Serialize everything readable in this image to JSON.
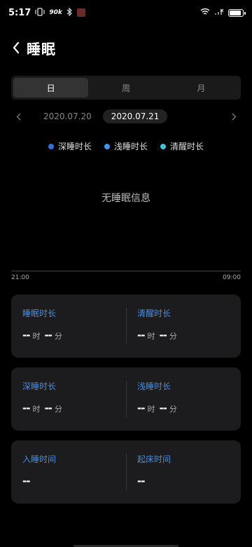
{
  "status": {
    "time": "5:17",
    "speed": "90k"
  },
  "page": {
    "title": "睡眠"
  },
  "tabs": [
    {
      "label": "日"
    },
    {
      "label": "周"
    },
    {
      "label": "月"
    }
  ],
  "date": {
    "previous": "2020.07.20",
    "current": "2020.07.21"
  },
  "legend": [
    {
      "label": "深睡时长",
      "color": "#2f73d8"
    },
    {
      "label": "浅睡时长",
      "color": "#3e97ec"
    },
    {
      "label": "清醒时长",
      "color": "#36c6d8"
    }
  ],
  "empty_message": "无睡眠信息",
  "axis": {
    "start": "21:00",
    "end": "09:00"
  },
  "cards": {
    "sleep_duration": {
      "label": "睡眠时长",
      "hours": "--",
      "hour_unit": "时",
      "minutes": "--",
      "minute_unit": "分"
    },
    "awake_duration": {
      "label": "清醒时长",
      "hours": "--",
      "hour_unit": "时",
      "minutes": "--",
      "minute_unit": "分"
    },
    "deep_duration": {
      "label": "深睡时长",
      "hours": "--",
      "hour_unit": "时",
      "minutes": "--",
      "minute_unit": "分"
    },
    "light_duration": {
      "label": "浅睡时长",
      "hours": "--",
      "hour_unit": "时",
      "minutes": "--",
      "minute_unit": "分"
    },
    "bedtime": {
      "label": "入睡时间",
      "value": "--"
    },
    "wake_time": {
      "label": "起床时间",
      "value": "--"
    }
  }
}
